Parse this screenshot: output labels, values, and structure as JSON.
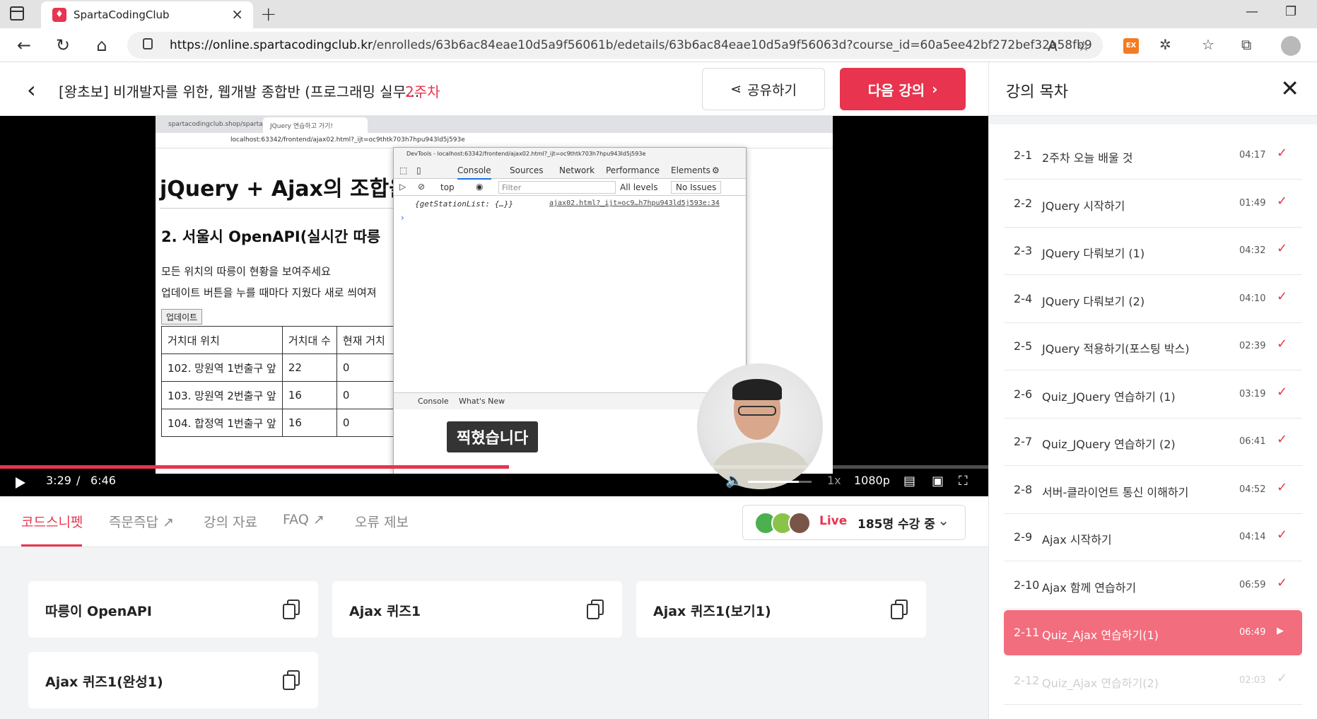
{
  "browser": {
    "tab_title": "SpartaCodingClub",
    "tab_favicon": "sparta-logo-icon",
    "url_host": "https://online.spartacodingclub.kr",
    "url_path": "/enrolleds/63b6ac84eae10d5a9f56061b/edetails/63b6ac84eae10d5a9f56063d?course_id=60a5ee42bf272bef32a58fb9",
    "extension_label": "EX"
  },
  "header": {
    "course_title": "[왕초보] 비개발자를 위한, 웹개발 종합반 (프로그래밍 실무...",
    "week": "2주차",
    "share_label": "공유하기",
    "next_label": "다음 강의"
  },
  "video": {
    "mini_tabs": [
      "spartacodingclub.shop/sparta_a...",
      "JQuery 연습하고 가기!"
    ],
    "mini_url": "localhost:63342/frontend/ajax02.html?_ijt=oc9thtk703h7hpu943ld5j593e",
    "page_h1": "jQuery + Ajax의 조합을",
    "page_h2": "2. 서울시 OpenAPI(실시간 따릉",
    "page_p1": "모든 위치의 따릉이 현황을 보여주세요",
    "page_p2": "업데이트 버튼을 누를 때마다 지웠다 새로 씌여져",
    "update_button": "업데이트",
    "table_header": [
      "거치대 위치",
      "거치대 수",
      "현재 거치"
    ],
    "table_rows": [
      [
        "102. 망원역 1번출구 앞",
        "22",
        "0"
      ],
      [
        "103. 망원역 2번출구 앞",
        "16",
        "0"
      ],
      [
        "104. 합정역 1번출구 앞",
        "16",
        "0"
      ]
    ],
    "devtools": {
      "window_title": "DevTools - localhost:63342/frontend/ajax02.html?_ijt=oc9thtk703h7hpu943ld5j593e",
      "tabs": [
        "Console",
        "Sources",
        "Network",
        "Performance",
        "Elements"
      ],
      "context": "top",
      "filter_placeholder": "Filter",
      "levels": "All levels",
      "issues": "No Issues",
      "log_text": "{getStationList: {…}}",
      "log_link": "ajax02.html?_ijt=oc9…h7hpu943ld5j593e:34",
      "drawer_tabs": [
        "Console",
        "What's New"
      ]
    },
    "subtitle": "찍혔습니다",
    "current_time": "3:29",
    "separator": "/",
    "duration": "6:46",
    "progress": 0.515,
    "buffered": 0.67,
    "volume": 0.8,
    "speed": "1x",
    "quality": "1080p"
  },
  "info_tabs": {
    "items": [
      "코드스니펫",
      "즉문즉답",
      "강의 자료",
      "FAQ",
      "오류 제보"
    ],
    "live_label": "Live",
    "live_count": "185명 수강 중"
  },
  "snippets": [
    "따릉이 OpenAPI",
    "Ajax 퀴즈1",
    "Ajax 퀴즈1(보기1)",
    "Ajax 퀴즈1(완성1)"
  ],
  "toc": {
    "title": "강의 목차",
    "items": [
      {
        "num": "2-1",
        "name": "2주차 오늘 배울 것",
        "duration": "04:17",
        "status": "done"
      },
      {
        "num": "2-2",
        "name": "JQuery 시작하기",
        "duration": "01:49",
        "status": "done"
      },
      {
        "num": "2-3",
        "name": "JQuery 다뤄보기 (1)",
        "duration": "04:32",
        "status": "done"
      },
      {
        "num": "2-4",
        "name": "JQuery 다뤄보기 (2)",
        "duration": "04:10",
        "status": "done"
      },
      {
        "num": "2-5",
        "name": "JQuery 적용하기(포스팅 박스)",
        "duration": "02:39",
        "status": "done"
      },
      {
        "num": "2-6",
        "name": "Quiz_JQuery 연습하기 (1)",
        "duration": "03:19",
        "status": "done"
      },
      {
        "num": "2-7",
        "name": "Quiz_JQuery 연습하기 (2)",
        "duration": "06:41",
        "status": "done"
      },
      {
        "num": "2-8",
        "name": "서버-클라이언트 통신 이해하기",
        "duration": "04:52",
        "status": "done"
      },
      {
        "num": "2-9",
        "name": "Ajax 시작하기",
        "duration": "04:14",
        "status": "done"
      },
      {
        "num": "2-10",
        "name": "Ajax 함께 연습하기",
        "duration": "06:59",
        "status": "done"
      },
      {
        "num": "2-11",
        "name": "Quiz_Ajax 연습하기(1)",
        "duration": "06:49",
        "status": "current"
      },
      {
        "num": "2-12",
        "name": "Quiz_Ajax 연습하기(2)",
        "duration": "02:03",
        "status": "todo"
      }
    ]
  },
  "colors": {
    "brand": "#e8344e",
    "current_item": "#f26d7d"
  }
}
